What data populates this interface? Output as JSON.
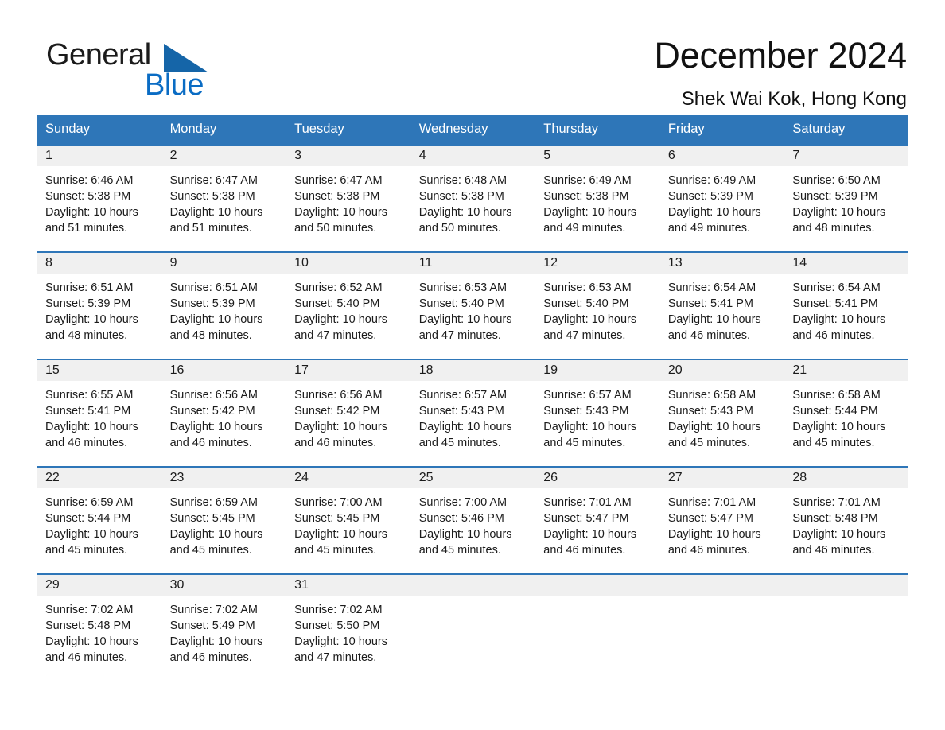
{
  "brand": {
    "name_part1": "General",
    "name_part2": "Blue",
    "triangle_icon": "blue-triangle-logo-icon",
    "accent_color": "#0a6cc4"
  },
  "header": {
    "title": "December 2024",
    "subtitle": "Shek Wai Kok, Hong Kong"
  },
  "theme": {
    "header_blue": "#2E76B8",
    "daynum_band": "#F0F0F0",
    "text": "#1b1b1b"
  },
  "calendar": {
    "month": "December",
    "year": "2024",
    "location": "Shek Wai Kok, Hong Kong",
    "weekday_headers": [
      "Sunday",
      "Monday",
      "Tuesday",
      "Wednesday",
      "Thursday",
      "Friday",
      "Saturday"
    ],
    "weeks": [
      [
        {
          "day": "1",
          "sunrise": "Sunrise: 6:46 AM",
          "sunset": "Sunset: 5:38 PM",
          "daylight_line1": "Daylight: 10 hours",
          "daylight_line2": "and 51 minutes."
        },
        {
          "day": "2",
          "sunrise": "Sunrise: 6:47 AM",
          "sunset": "Sunset: 5:38 PM",
          "daylight_line1": "Daylight: 10 hours",
          "daylight_line2": "and 51 minutes."
        },
        {
          "day": "3",
          "sunrise": "Sunrise: 6:47 AM",
          "sunset": "Sunset: 5:38 PM",
          "daylight_line1": "Daylight: 10 hours",
          "daylight_line2": "and 50 minutes."
        },
        {
          "day": "4",
          "sunrise": "Sunrise: 6:48 AM",
          "sunset": "Sunset: 5:38 PM",
          "daylight_line1": "Daylight: 10 hours",
          "daylight_line2": "and 50 minutes."
        },
        {
          "day": "5",
          "sunrise": "Sunrise: 6:49 AM",
          "sunset": "Sunset: 5:38 PM",
          "daylight_line1": "Daylight: 10 hours",
          "daylight_line2": "and 49 minutes."
        },
        {
          "day": "6",
          "sunrise": "Sunrise: 6:49 AM",
          "sunset": "Sunset: 5:39 PM",
          "daylight_line1": "Daylight: 10 hours",
          "daylight_line2": "and 49 minutes."
        },
        {
          "day": "7",
          "sunrise": "Sunrise: 6:50 AM",
          "sunset": "Sunset: 5:39 PM",
          "daylight_line1": "Daylight: 10 hours",
          "daylight_line2": "and 48 minutes."
        }
      ],
      [
        {
          "day": "8",
          "sunrise": "Sunrise: 6:51 AM",
          "sunset": "Sunset: 5:39 PM",
          "daylight_line1": "Daylight: 10 hours",
          "daylight_line2": "and 48 minutes."
        },
        {
          "day": "9",
          "sunrise": "Sunrise: 6:51 AM",
          "sunset": "Sunset: 5:39 PM",
          "daylight_line1": "Daylight: 10 hours",
          "daylight_line2": "and 48 minutes."
        },
        {
          "day": "10",
          "sunrise": "Sunrise: 6:52 AM",
          "sunset": "Sunset: 5:40 PM",
          "daylight_line1": "Daylight: 10 hours",
          "daylight_line2": "and 47 minutes."
        },
        {
          "day": "11",
          "sunrise": "Sunrise: 6:53 AM",
          "sunset": "Sunset: 5:40 PM",
          "daylight_line1": "Daylight: 10 hours",
          "daylight_line2": "and 47 minutes."
        },
        {
          "day": "12",
          "sunrise": "Sunrise: 6:53 AM",
          "sunset": "Sunset: 5:40 PM",
          "daylight_line1": "Daylight: 10 hours",
          "daylight_line2": "and 47 minutes."
        },
        {
          "day": "13",
          "sunrise": "Sunrise: 6:54 AM",
          "sunset": "Sunset: 5:41 PM",
          "daylight_line1": "Daylight: 10 hours",
          "daylight_line2": "and 46 minutes."
        },
        {
          "day": "14",
          "sunrise": "Sunrise: 6:54 AM",
          "sunset": "Sunset: 5:41 PM",
          "daylight_line1": "Daylight: 10 hours",
          "daylight_line2": "and 46 minutes."
        }
      ],
      [
        {
          "day": "15",
          "sunrise": "Sunrise: 6:55 AM",
          "sunset": "Sunset: 5:41 PM",
          "daylight_line1": "Daylight: 10 hours",
          "daylight_line2": "and 46 minutes."
        },
        {
          "day": "16",
          "sunrise": "Sunrise: 6:56 AM",
          "sunset": "Sunset: 5:42 PM",
          "daylight_line1": "Daylight: 10 hours",
          "daylight_line2": "and 46 minutes."
        },
        {
          "day": "17",
          "sunrise": "Sunrise: 6:56 AM",
          "sunset": "Sunset: 5:42 PM",
          "daylight_line1": "Daylight: 10 hours",
          "daylight_line2": "and 46 minutes."
        },
        {
          "day": "18",
          "sunrise": "Sunrise: 6:57 AM",
          "sunset": "Sunset: 5:43 PM",
          "daylight_line1": "Daylight: 10 hours",
          "daylight_line2": "and 45 minutes."
        },
        {
          "day": "19",
          "sunrise": "Sunrise: 6:57 AM",
          "sunset": "Sunset: 5:43 PM",
          "daylight_line1": "Daylight: 10 hours",
          "daylight_line2": "and 45 minutes."
        },
        {
          "day": "20",
          "sunrise": "Sunrise: 6:58 AM",
          "sunset": "Sunset: 5:43 PM",
          "daylight_line1": "Daylight: 10 hours",
          "daylight_line2": "and 45 minutes."
        },
        {
          "day": "21",
          "sunrise": "Sunrise: 6:58 AM",
          "sunset": "Sunset: 5:44 PM",
          "daylight_line1": "Daylight: 10 hours",
          "daylight_line2": "and 45 minutes."
        }
      ],
      [
        {
          "day": "22",
          "sunrise": "Sunrise: 6:59 AM",
          "sunset": "Sunset: 5:44 PM",
          "daylight_line1": "Daylight: 10 hours",
          "daylight_line2": "and 45 minutes."
        },
        {
          "day": "23",
          "sunrise": "Sunrise: 6:59 AM",
          "sunset": "Sunset: 5:45 PM",
          "daylight_line1": "Daylight: 10 hours",
          "daylight_line2": "and 45 minutes."
        },
        {
          "day": "24",
          "sunrise": "Sunrise: 7:00 AM",
          "sunset": "Sunset: 5:45 PM",
          "daylight_line1": "Daylight: 10 hours",
          "daylight_line2": "and 45 minutes."
        },
        {
          "day": "25",
          "sunrise": "Sunrise: 7:00 AM",
          "sunset": "Sunset: 5:46 PM",
          "daylight_line1": "Daylight: 10 hours",
          "daylight_line2": "and 45 minutes."
        },
        {
          "day": "26",
          "sunrise": "Sunrise: 7:01 AM",
          "sunset": "Sunset: 5:47 PM",
          "daylight_line1": "Daylight: 10 hours",
          "daylight_line2": "and 46 minutes."
        },
        {
          "day": "27",
          "sunrise": "Sunrise: 7:01 AM",
          "sunset": "Sunset: 5:47 PM",
          "daylight_line1": "Daylight: 10 hours",
          "daylight_line2": "and 46 minutes."
        },
        {
          "day": "28",
          "sunrise": "Sunrise: 7:01 AM",
          "sunset": "Sunset: 5:48 PM",
          "daylight_line1": "Daylight: 10 hours",
          "daylight_line2": "and 46 minutes."
        }
      ],
      [
        {
          "day": "29",
          "sunrise": "Sunrise: 7:02 AM",
          "sunset": "Sunset: 5:48 PM",
          "daylight_line1": "Daylight: 10 hours",
          "daylight_line2": "and 46 minutes."
        },
        {
          "day": "30",
          "sunrise": "Sunrise: 7:02 AM",
          "sunset": "Sunset: 5:49 PM",
          "daylight_line1": "Daylight: 10 hours",
          "daylight_line2": "and 46 minutes."
        },
        {
          "day": "31",
          "sunrise": "Sunrise: 7:02 AM",
          "sunset": "Sunset: 5:50 PM",
          "daylight_line1": "Daylight: 10 hours",
          "daylight_line2": "and 47 minutes."
        },
        {
          "day": "",
          "sunrise": "",
          "sunset": "",
          "daylight_line1": "",
          "daylight_line2": ""
        },
        {
          "day": "",
          "sunrise": "",
          "sunset": "",
          "daylight_line1": "",
          "daylight_line2": ""
        },
        {
          "day": "",
          "sunrise": "",
          "sunset": "",
          "daylight_line1": "",
          "daylight_line2": ""
        },
        {
          "day": "",
          "sunrise": "",
          "sunset": "",
          "daylight_line1": "",
          "daylight_line2": ""
        }
      ]
    ]
  }
}
